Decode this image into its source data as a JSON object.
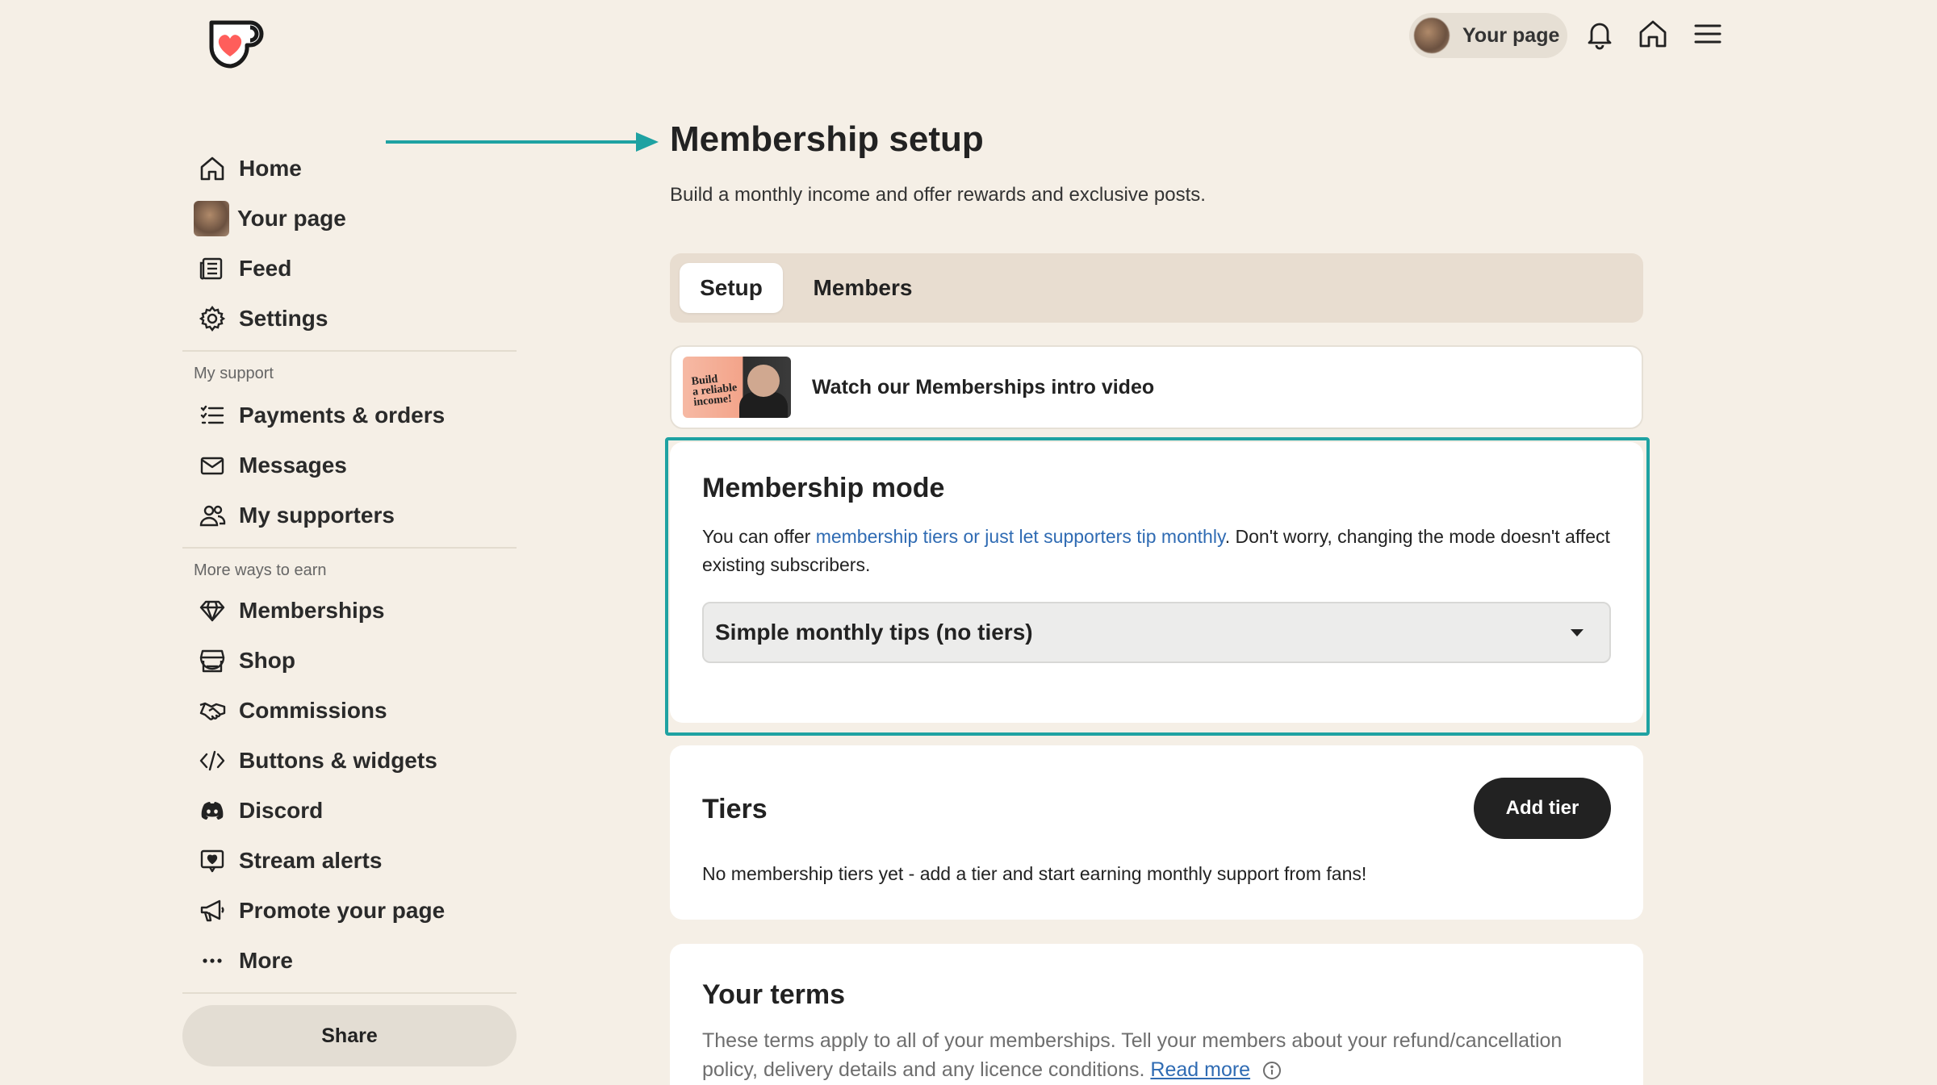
{
  "header": {
    "your_page_label": "Your page",
    "icons": [
      "bell-icon",
      "home-icon",
      "menu-icon"
    ]
  },
  "sidebar": {
    "items_main": [
      {
        "label": "Home",
        "icon": "home-icon"
      },
      {
        "label": "Your page",
        "icon": "avatar"
      },
      {
        "label": "Feed",
        "icon": "feed-icon"
      },
      {
        "label": "Settings",
        "icon": "gear-icon"
      }
    ],
    "section_support": "My support",
    "items_support": [
      {
        "label": "Payments & orders",
        "icon": "list-icon"
      },
      {
        "label": "Messages",
        "icon": "mail-icon"
      },
      {
        "label": "My supporters",
        "icon": "users-icon"
      }
    ],
    "section_earn": "More ways to earn",
    "items_earn": [
      {
        "label": "Memberships",
        "icon": "diamond-icon"
      },
      {
        "label": "Shop",
        "icon": "shop-icon"
      },
      {
        "label": "Commissions",
        "icon": "handshake-icon"
      },
      {
        "label": "Buttons & widgets",
        "icon": "code-icon"
      },
      {
        "label": "Discord",
        "icon": "discord-icon"
      },
      {
        "label": "Stream alerts",
        "icon": "alert-icon"
      },
      {
        "label": "Promote your page",
        "icon": "megaphone-icon"
      },
      {
        "label": "More",
        "icon": "more-icon"
      }
    ],
    "share_label": "Share"
  },
  "main": {
    "title": "Membership setup",
    "subtitle": "Build a monthly income and offer rewards and exclusive posts.",
    "tabs": [
      {
        "label": "Setup",
        "active": true
      },
      {
        "label": "Members",
        "active": false
      }
    ],
    "video": {
      "label": "Watch our Memberships intro video",
      "thumb_text": "Build a reliable income!"
    },
    "mode": {
      "title": "Membership mode",
      "desc_prefix": "You can offer ",
      "desc_link": "membership tiers or just let supporters tip monthly",
      "desc_suffix": ". Don't worry, changing the mode doesn't affect existing subscribers.",
      "select_value": "Simple monthly tips (no tiers)"
    },
    "tiers": {
      "title": "Tiers",
      "add_label": "Add tier",
      "note": "No membership tiers yet - add a tier and start earning monthly support from fans!"
    },
    "terms": {
      "title": "Your terms",
      "desc": "These terms apply to all of your memberships. Tell your members about your refund/cancellation policy, delivery details and any licence conditions. ",
      "read_more": "Read more"
    }
  },
  "colors": {
    "background": "#f5efe6",
    "accent_teal": "#1fa2a2",
    "logo_red": "#ff5e5b",
    "link_blue": "#2f6bb3"
  }
}
